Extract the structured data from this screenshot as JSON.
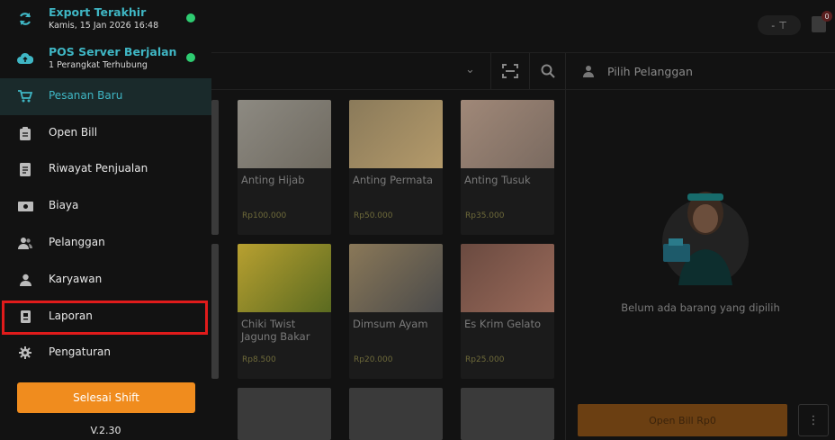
{
  "drawer": {
    "status": [
      {
        "title": "Export Terakhir",
        "subtitle": "Kamis, 15 Jan 2026 16:48",
        "icon": "sync-icon"
      },
      {
        "title": "POS Server Berjalan",
        "subtitle": "1 Perangkat Terhubung",
        "icon": "cloud-upload-icon"
      }
    ],
    "menu": [
      {
        "label": "Pesanan Baru",
        "icon": "cart-icon"
      },
      {
        "label": "Open Bill",
        "icon": "clipboard-icon"
      },
      {
        "label": "Riwayat Penjualan",
        "icon": "document-icon"
      },
      {
        "label": "Biaya",
        "icon": "money-icon"
      },
      {
        "label": "Pelanggan",
        "icon": "users-icon"
      },
      {
        "label": "Karyawan",
        "icon": "person-icon"
      },
      {
        "label": "Laporan",
        "icon": "report-icon"
      },
      {
        "label": "Pengaturan",
        "icon": "gear-icon"
      }
    ],
    "shift_button": "Selesai Shift",
    "version": "V.2.30"
  },
  "topbar": {
    "pill_text": "-",
    "cart_badge": "0"
  },
  "products": [
    {
      "name": "Anting Hijab",
      "price": "Rp100.000"
    },
    {
      "name": "Anting Permata",
      "price": "Rp50.000"
    },
    {
      "name": "Anting Tusuk",
      "price": "Rp35.000"
    },
    {
      "name": "Chiki Twist Jagung Bakar",
      "price": "Rp8.500"
    },
    {
      "name": "Dimsum Ayam",
      "price": "Rp20.000"
    },
    {
      "name": "Es Krim Gelato",
      "price": "Rp25.000"
    }
  ],
  "right_panel": {
    "customer_label": "Pilih Pelanggan",
    "empty_text": "Belum ada barang yang dipilih",
    "open_bill_button": "Open Bill Rp0"
  },
  "colors": {
    "accent": "#3fb6c4",
    "brand_orange": "#f08c1e",
    "status_green": "#2ecc71",
    "highlight": "#e01b1b"
  }
}
